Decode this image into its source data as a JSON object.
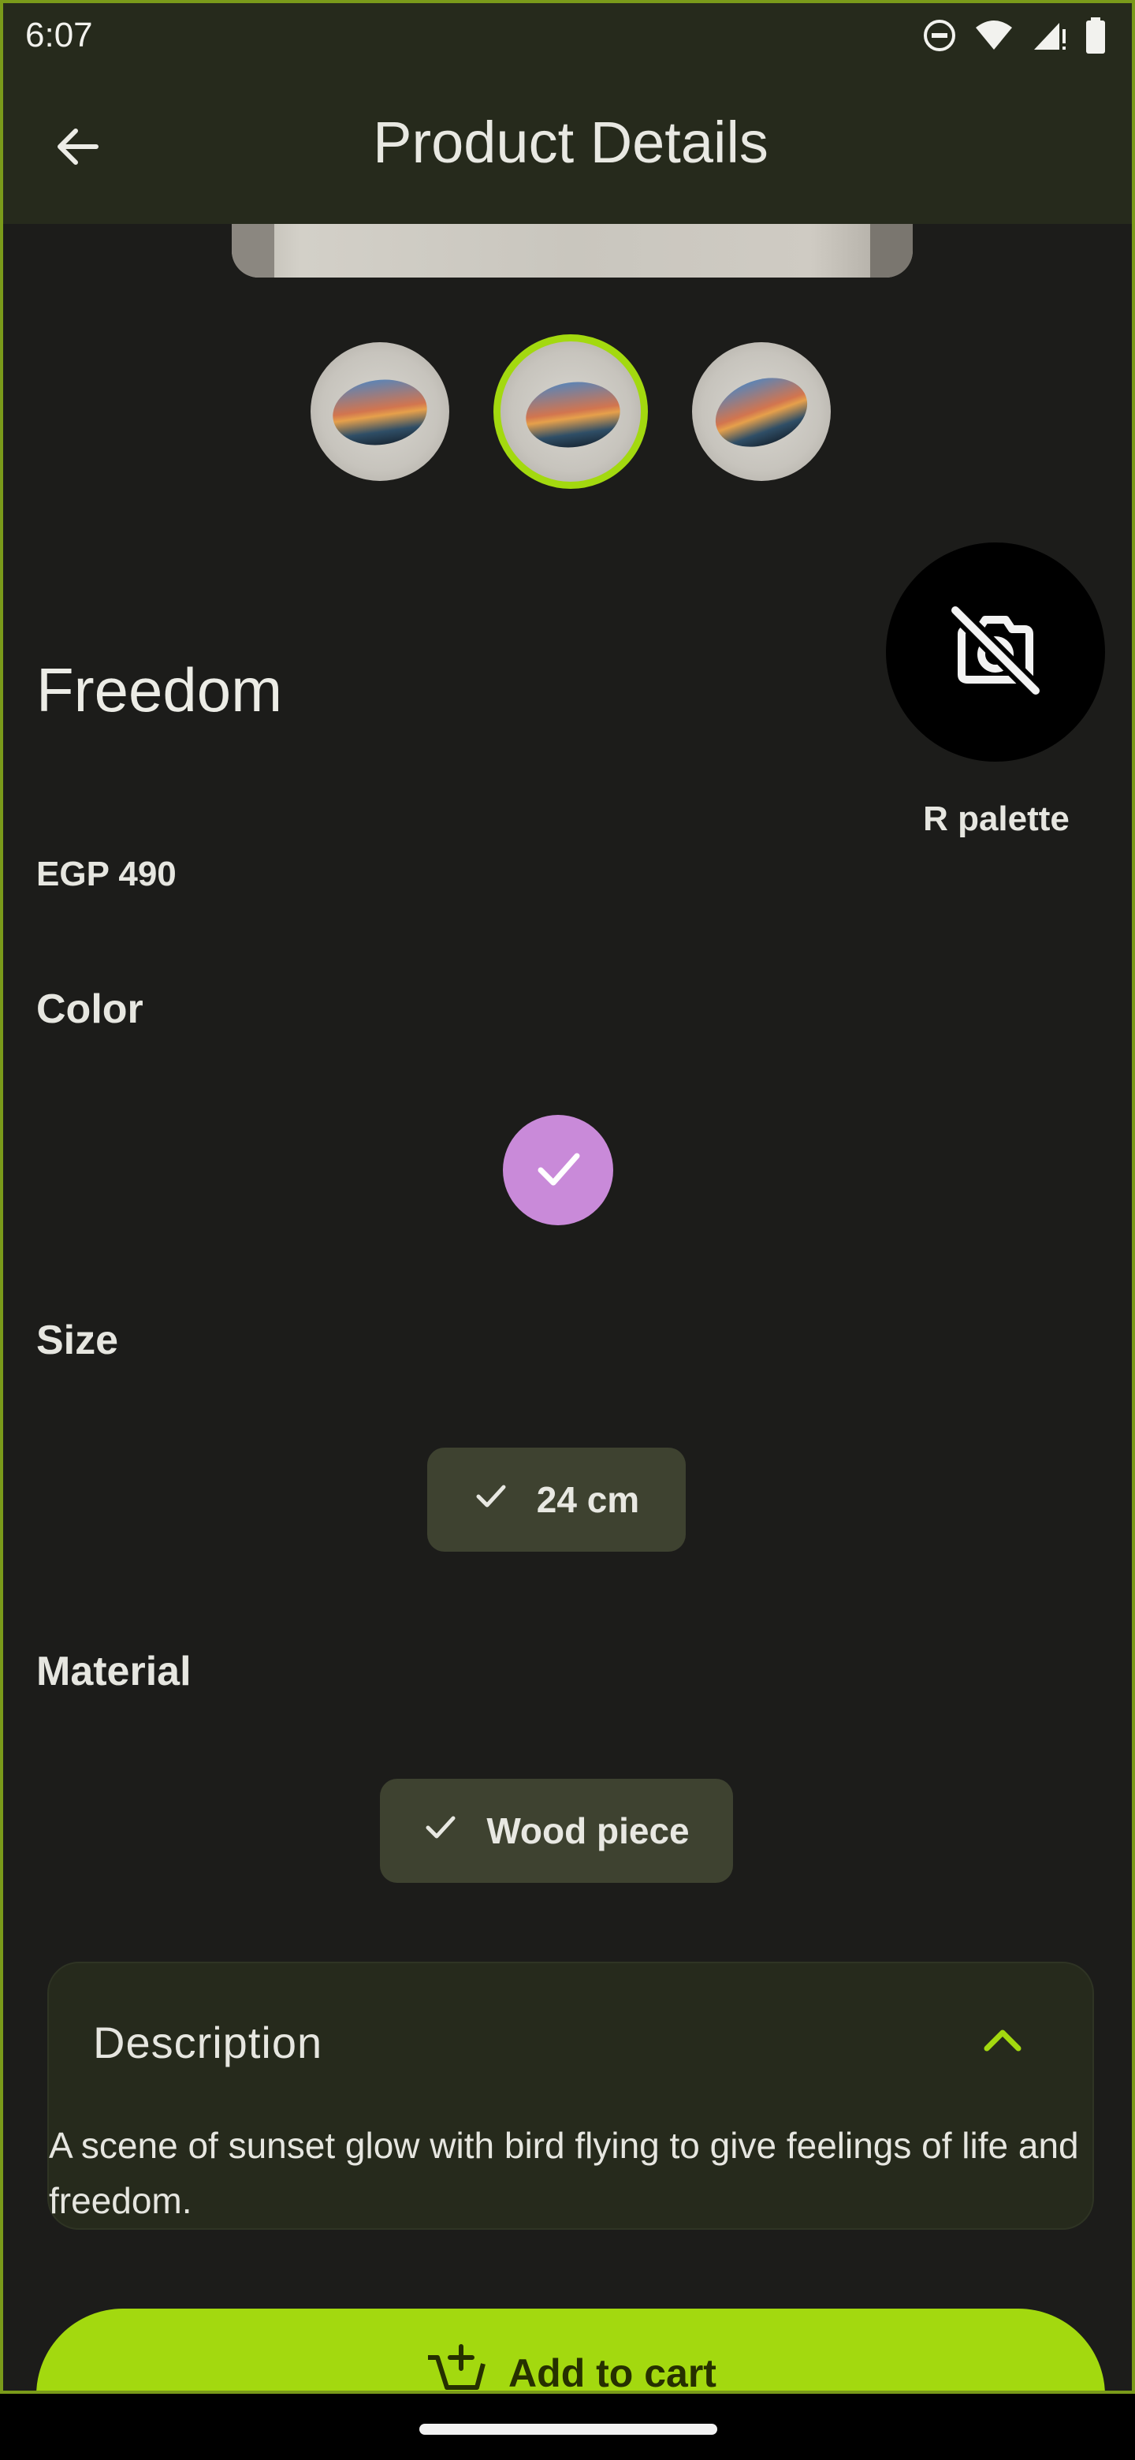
{
  "status_bar": {
    "time": "6:07",
    "icons": [
      "do-not-disturb-icon",
      "wifi-icon",
      "signal-icon",
      "battery-icon"
    ]
  },
  "app_bar": {
    "title": "Product Details",
    "back_icon": "arrow-left-icon"
  },
  "gallery": {
    "thumbnails": [
      "image-1",
      "image-2",
      "image-3"
    ],
    "selected_index": 1
  },
  "product": {
    "name": "Freedom",
    "price": "EGP 490",
    "seller": {
      "name": "R palette",
      "avatar_icon": "no-photo-icon"
    }
  },
  "options": {
    "color": {
      "label": "Color",
      "selected_color": "#c98ad9"
    },
    "size": {
      "label": "Size",
      "selected": "24 cm"
    },
    "material": {
      "label": "Material",
      "selected": "Wood piece"
    }
  },
  "description": {
    "title": "Description",
    "body": "A scene of sunset glow with bird flying to give feelings of life and freedom.",
    "expanded": true
  },
  "cart_button": {
    "label": "Add to cart",
    "icon": "add-shopping-cart-icon"
  },
  "colors": {
    "accent": "#a3d90f",
    "background": "#1c1c1a",
    "app_bar": "#262a1c",
    "chip": "#3e4230"
  }
}
